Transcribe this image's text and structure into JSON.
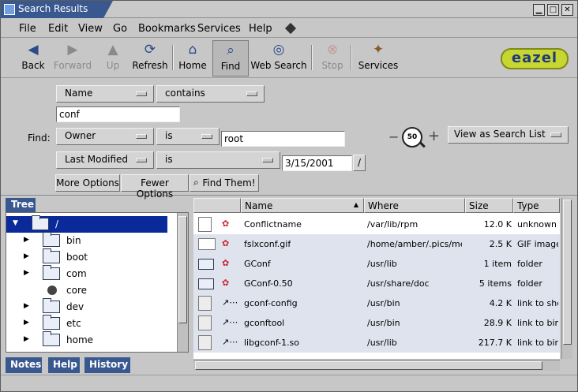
{
  "window": {
    "title": "Search Results",
    "minimize": "▁",
    "maximize": "□",
    "close": "✕"
  },
  "menu": [
    {
      "label": "File"
    },
    {
      "label": "Edit"
    },
    {
      "label": "View"
    },
    {
      "label": "Go"
    },
    {
      "label": "Bookmarks"
    },
    {
      "label": "Services"
    },
    {
      "label": "Help"
    }
  ],
  "toolbar": {
    "back": "Back",
    "forward": "Forward",
    "up": "Up",
    "refresh": "Refresh",
    "home": "Home",
    "find": "Find",
    "web_search": "Web Search",
    "stop": "Stop",
    "services": "Services"
  },
  "logo": "eazel",
  "search": {
    "find_label": "Find:",
    "row1": {
      "field": "Name",
      "op": "contains",
      "value": "conf"
    },
    "row2": {
      "field": "Owner",
      "op": "is",
      "value": "root"
    },
    "row3": {
      "field": "Last Modified",
      "op": "is",
      "value": "3/15/2001",
      "cal": "/"
    },
    "more_options": "More Options",
    "fewer_options": "Fewer Options",
    "find_them": "Find Them!",
    "zoom_level": "50",
    "zoom_minus": "−",
    "zoom_plus": "+",
    "view_as": "View as Search List"
  },
  "sidebar": {
    "tab_tree": "Tree",
    "tree": [
      {
        "name": "/",
        "expanded": true
      },
      {
        "name": "bin"
      },
      {
        "name": "boot"
      },
      {
        "name": "com"
      },
      {
        "name": "core"
      },
      {
        "name": "dev"
      },
      {
        "name": "etc"
      },
      {
        "name": "home"
      }
    ],
    "tabs": [
      {
        "label": "Notes"
      },
      {
        "label": "Help"
      },
      {
        "label": "History"
      }
    ]
  },
  "list": {
    "columns": [
      "Name",
      "Where",
      "Size",
      "Type"
    ],
    "rows": [
      {
        "name": "Conflictname",
        "where": "/var/lib/rpm",
        "size": "12.0 K",
        "type": "unknown ty"
      },
      {
        "name": "fslxconf.gif",
        "where": "/home/amber/.pics/med",
        "size": "2.5 K",
        "type": "GIF image"
      },
      {
        "name": "GConf",
        "where": "/usr/lib",
        "size": "1 item",
        "type": "folder"
      },
      {
        "name": "GConf-0.50",
        "where": "/usr/share/doc",
        "size": "5 items",
        "type": "folder"
      },
      {
        "name": "gconf-config",
        "where": "/usr/bin",
        "size": "4.2 K",
        "type": "link to shell"
      },
      {
        "name": "gconftool",
        "where": "/usr/bin",
        "size": "28.9 K",
        "type": "link to binar"
      },
      {
        "name": "libgconf-1.so",
        "where": "/usr/lib",
        "size": "217.7 K",
        "type": "link to binar"
      }
    ]
  }
}
